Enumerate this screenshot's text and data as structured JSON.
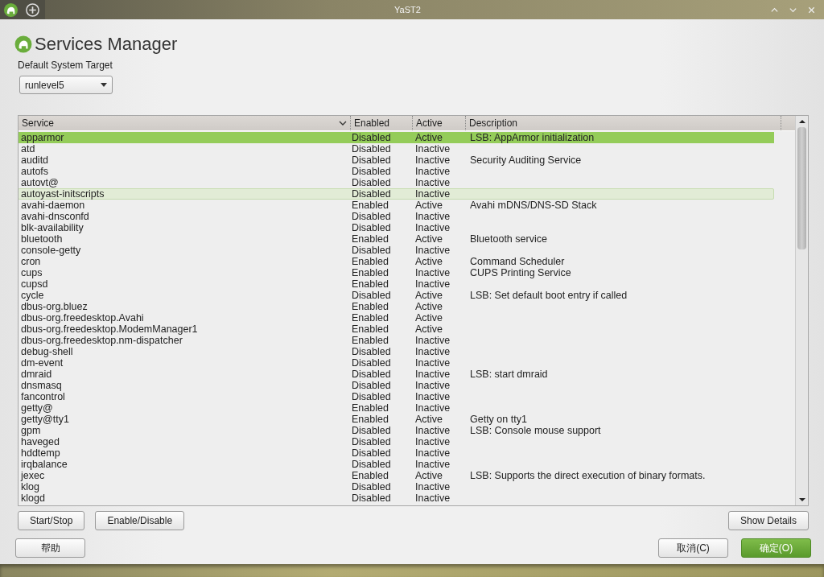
{
  "window": {
    "title": "YaST2"
  },
  "heading": "Services Manager",
  "target": {
    "label": "Default System Target",
    "value": "runlevel5"
  },
  "table": {
    "columns": [
      "Service",
      "Enabled",
      "Active",
      "Description"
    ],
    "rows": [
      {
        "service": "apparmor",
        "enabled": "Disabled",
        "active": "Active",
        "description": "LSB: AppArmor initialization",
        "selected": true,
        "hovered": false
      },
      {
        "service": "atd",
        "enabled": "Disabled",
        "active": "Inactive",
        "selected": false,
        "hovered": false
      },
      {
        "service": "auditd",
        "enabled": "Disabled",
        "active": "Inactive",
        "description": "Security Auditing Service",
        "selected": false,
        "hovered": false
      },
      {
        "service": "autofs",
        "enabled": "Disabled",
        "active": "Inactive",
        "selected": false,
        "hovered": false
      },
      {
        "service": "autovt@",
        "enabled": "Disabled",
        "active": "Inactive",
        "selected": false,
        "hovered": false
      },
      {
        "service": "autoyast-initscripts",
        "enabled": "Disabled",
        "active": "Inactive",
        "selected": false,
        "hovered": true
      },
      {
        "service": "avahi-daemon",
        "enabled": "Enabled",
        "active": "Active",
        "description": "Avahi mDNS/DNS-SD Stack",
        "selected": false,
        "hovered": false
      },
      {
        "service": "avahi-dnsconfd",
        "enabled": "Disabled",
        "active": "Inactive",
        "selected": false,
        "hovered": false
      },
      {
        "service": "blk-availability",
        "enabled": "Disabled",
        "active": "Inactive",
        "selected": false,
        "hovered": false
      },
      {
        "service": "bluetooth",
        "enabled": "Enabled",
        "active": "Active",
        "description": "Bluetooth service",
        "selected": false,
        "hovered": false
      },
      {
        "service": "console-getty",
        "enabled": "Disabled",
        "active": "Inactive",
        "selected": false,
        "hovered": false
      },
      {
        "service": "cron",
        "enabled": "Enabled",
        "active": "Active",
        "description": "Command Scheduler",
        "selected": false,
        "hovered": false
      },
      {
        "service": "cups",
        "enabled": "Enabled",
        "active": "Inactive",
        "description": "CUPS Printing Service",
        "selected": false,
        "hovered": false
      },
      {
        "service": "cupsd",
        "enabled": "Enabled",
        "active": "Inactive",
        "selected": false,
        "hovered": false
      },
      {
        "service": "cycle",
        "enabled": "Disabled",
        "active": "Active",
        "description": "LSB: Set default boot entry if called",
        "selected": false,
        "hovered": false
      },
      {
        "service": "dbus-org.bluez",
        "enabled": "Enabled",
        "active": "Active",
        "selected": false,
        "hovered": false
      },
      {
        "service": "dbus-org.freedesktop.Avahi",
        "enabled": "Enabled",
        "active": "Active",
        "selected": false,
        "hovered": false
      },
      {
        "service": "dbus-org.freedesktop.ModemManager1",
        "enabled": "Enabled",
        "active": "Active",
        "selected": false,
        "hovered": false
      },
      {
        "service": "dbus-org.freedesktop.nm-dispatcher",
        "enabled": "Enabled",
        "active": "Inactive",
        "selected": false,
        "hovered": false
      },
      {
        "service": "debug-shell",
        "enabled": "Disabled",
        "active": "Inactive",
        "selected": false,
        "hovered": false
      },
      {
        "service": "dm-event",
        "enabled": "Disabled",
        "active": "Inactive",
        "selected": false,
        "hovered": false
      },
      {
        "service": "dmraid",
        "enabled": "Disabled",
        "active": "Inactive",
        "description": "LSB: start dmraid",
        "selected": false,
        "hovered": false
      },
      {
        "service": "dnsmasq",
        "enabled": "Disabled",
        "active": "Inactive",
        "selected": false,
        "hovered": false
      },
      {
        "service": "fancontrol",
        "enabled": "Disabled",
        "active": "Inactive",
        "selected": false,
        "hovered": false
      },
      {
        "service": "getty@",
        "enabled": "Enabled",
        "active": "Inactive",
        "selected": false,
        "hovered": false
      },
      {
        "service": "getty@tty1",
        "enabled": "Enabled",
        "active": "Active",
        "description": "Getty on tty1",
        "selected": false,
        "hovered": false
      },
      {
        "service": "gpm",
        "enabled": "Disabled",
        "active": "Inactive",
        "description": "LSB: Console mouse support",
        "selected": false,
        "hovered": false
      },
      {
        "service": "haveged",
        "enabled": "Disabled",
        "active": "Inactive",
        "selected": false,
        "hovered": false
      },
      {
        "service": "hddtemp",
        "enabled": "Disabled",
        "active": "Inactive",
        "selected": false,
        "hovered": false
      },
      {
        "service": "irqbalance",
        "enabled": "Disabled",
        "active": "Inactive",
        "selected": false,
        "hovered": false
      },
      {
        "service": "jexec",
        "enabled": "Enabled",
        "active": "Active",
        "description": "LSB: Supports the direct execution of binary formats.",
        "selected": false,
        "hovered": false
      },
      {
        "service": "klog",
        "enabled": "Disabled",
        "active": "Inactive",
        "selected": false,
        "hovered": false
      },
      {
        "service": "klogd",
        "enabled": "Disabled",
        "active": "Inactive",
        "selected": false,
        "hovered": false
      }
    ]
  },
  "actions": [
    "Start/Stop",
    "Enable/Disable"
  ],
  "details_button": "Show Details",
  "help_button": "帮助",
  "cancel_button": "取消(C)",
  "ok_button": "确定(O)"
}
